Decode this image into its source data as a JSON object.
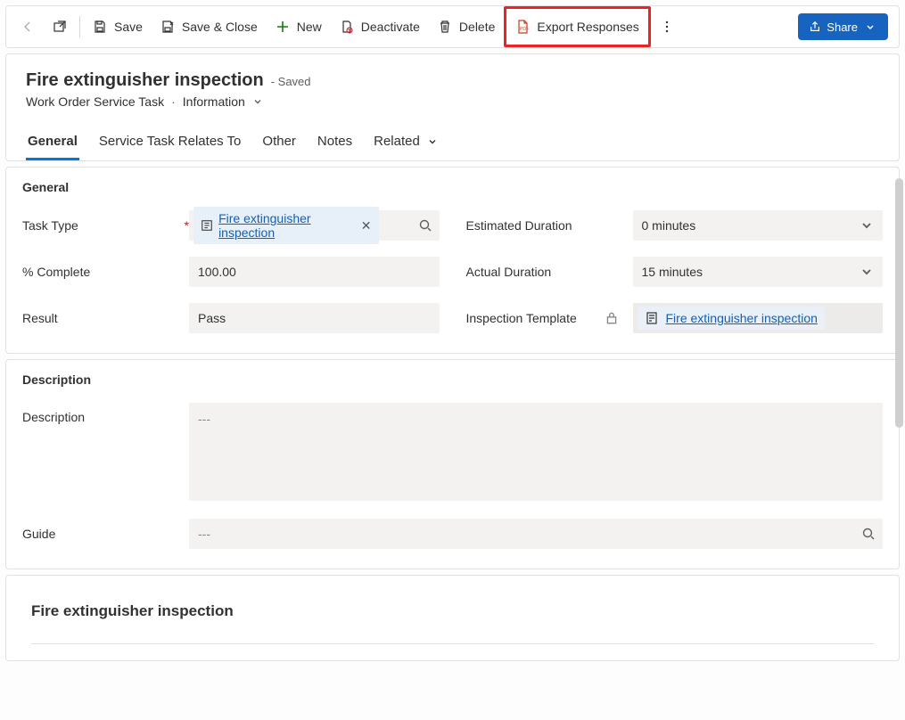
{
  "commands": {
    "save": "Save",
    "save_close": "Save & Close",
    "new": "New",
    "deactivate": "Deactivate",
    "delete": "Delete",
    "export_responses": "Export Responses",
    "share": "Share"
  },
  "header": {
    "title": "Fire extinguisher inspection",
    "state": "- Saved",
    "entity": "Work Order Service Task",
    "form_name": "Information"
  },
  "tabs": {
    "general": "General",
    "relates": "Service Task Relates To",
    "other": "Other",
    "notes": "Notes",
    "related": "Related"
  },
  "sections": {
    "general": "General",
    "description": "Description"
  },
  "fields": {
    "task_type_label": "Task Type",
    "task_type_value": "Fire extinguisher inspection",
    "pct_complete_label": "% Complete",
    "pct_complete_value": "100.00",
    "result_label": "Result",
    "result_value": "Pass",
    "est_duration_label": "Estimated Duration",
    "est_duration_value": "0 minutes",
    "act_duration_label": "Actual Duration",
    "act_duration_value": "15 minutes",
    "insp_template_label": "Inspection Template",
    "insp_template_value": "Fire extinguisher inspection",
    "description_label": "Description",
    "description_value": "---",
    "guide_label": "Guide",
    "guide_value": "---"
  },
  "inspection": {
    "title": "Fire extinguisher inspection"
  }
}
